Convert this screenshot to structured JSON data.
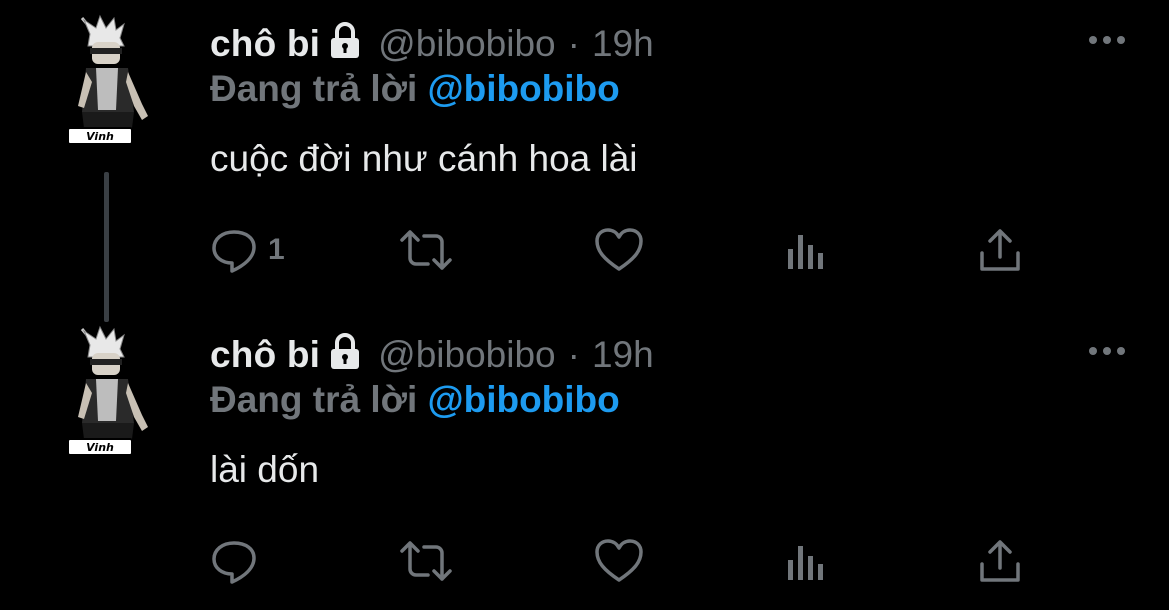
{
  "tweets": [
    {
      "display_name": "chô bi",
      "handle": "@bibobibo",
      "separator": "·",
      "time": "19h",
      "replying_prefix": "Đang trả lời",
      "replying_to": "@bibobibo",
      "text": "cuộc đời như cánh hoa lài",
      "reply_count": "1",
      "avatar_badge": "Vinh",
      "locked": true
    },
    {
      "display_name": "chô bi",
      "handle": "@bibobibo",
      "separator": "·",
      "time": "19h",
      "replying_prefix": "Đang trả lời",
      "replying_to": "@bibobibo",
      "text": "lài dốn",
      "reply_count": "",
      "avatar_badge": "Vinh",
      "locked": true
    }
  ],
  "colors": {
    "background": "#000000",
    "primary_text": "#e7e9ea",
    "secondary_text": "#71767b",
    "accent": "#1d9bf0",
    "thread_line": "#3a3f44"
  },
  "icons": {
    "lock": "lock-icon",
    "more": "more-icon",
    "reply": "reply-icon",
    "retweet": "retweet-icon",
    "like": "heart-icon",
    "views": "views-icon",
    "share": "share-icon"
  }
}
